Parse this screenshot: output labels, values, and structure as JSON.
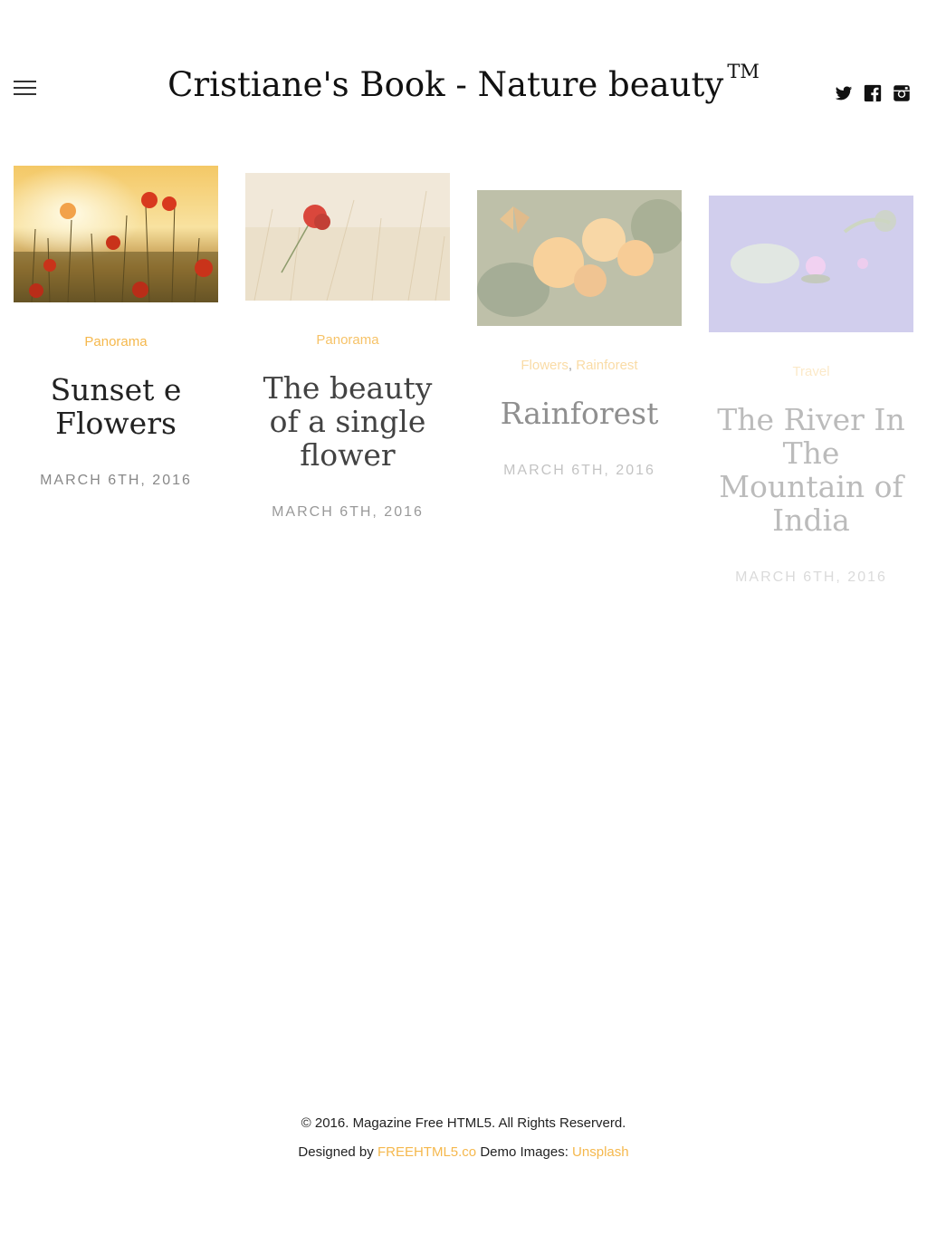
{
  "header": {
    "title": "Cristiane's Book - Nature beauty",
    "trademark": "TM",
    "menu_icon": "hamburger-menu-icon",
    "social_icons": [
      "twitter-icon",
      "facebook-icon",
      "instagram-icon"
    ]
  },
  "posts": [
    {
      "categories": [
        "Panorama"
      ],
      "title": "Sunset e Flowers",
      "date": "March 6th, 2016",
      "opacity": 1.0
    },
    {
      "categories": [
        "Panorama"
      ],
      "title": "The beauty of a single flower",
      "date": "March 6th, 2016",
      "opacity": 0.85
    },
    {
      "categories": [
        "Flowers",
        "Rainforest"
      ],
      "category_separator": ",",
      "title": "Rainforest",
      "date": "March 6th, 2016",
      "opacity": 0.5
    },
    {
      "categories": [
        "Travel"
      ],
      "title": "The River In The Mountain of India",
      "date": "March 6th, 2016",
      "opacity": 0.3
    }
  ],
  "footer": {
    "copyright": "© 2016. Magazine Free HTML5. All Rights Reserverd.",
    "designed_by_prefix": "Designed by",
    "designer_link": "FREEHTML5.co",
    "demo_images_prefix": "Demo Images:",
    "images_link": "Unsplash"
  },
  "colors": {
    "accent": "#f5b84d",
    "text": "#222222",
    "muted": "#888888"
  }
}
